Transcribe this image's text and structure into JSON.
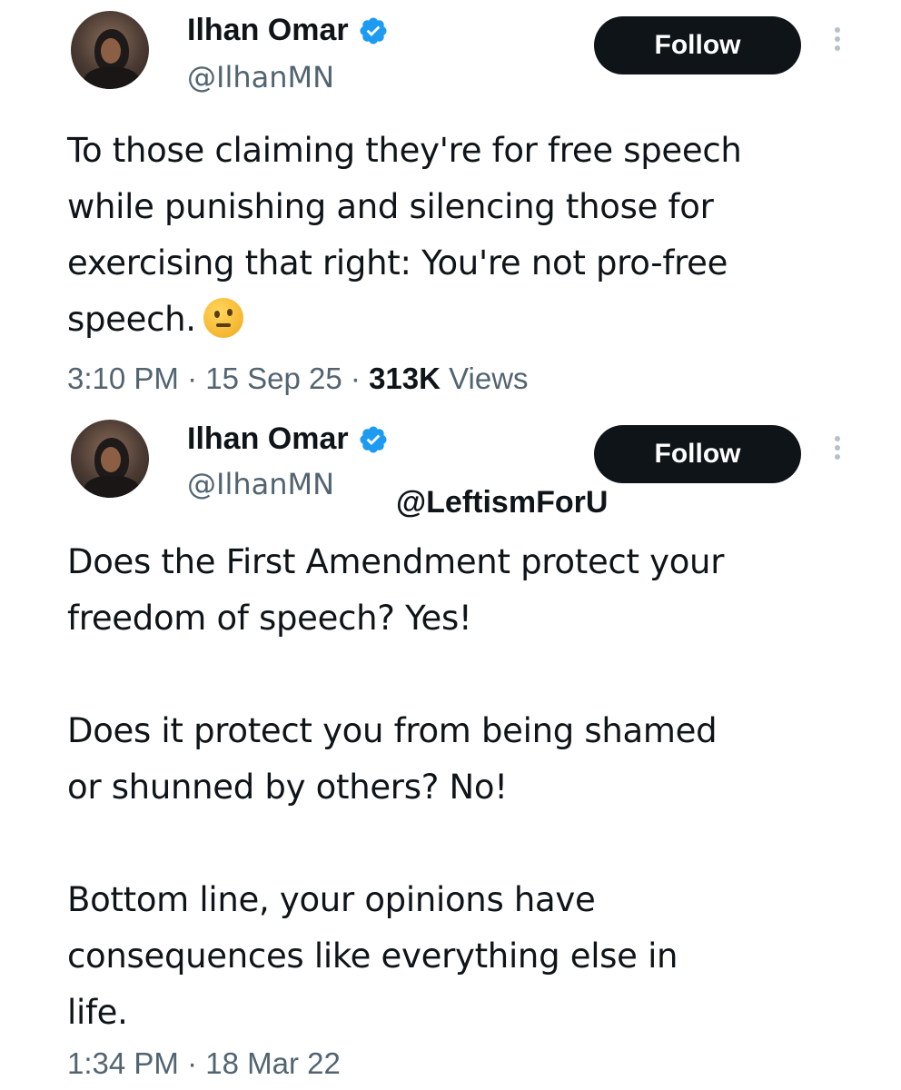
{
  "tweets": [
    {
      "display_name": "Ilhan Omar",
      "handle": "@IlhanMN",
      "follow_label": "Follow",
      "text": "To those claiming they're for free speech\nwhile punishing and silencing those for\nexercising that right: You're not pro-free\nspeech.",
      "emoji": "thinking-face-icon",
      "time": "3:10 PM",
      "date": "15 Sep 25",
      "views_count": "313K",
      "views_label": "Views"
    },
    {
      "display_name": "Ilhan Omar",
      "handle": "@IlhanMN",
      "follow_label": "Follow",
      "text": "Does the First Amendment protect your\nfreedom of speech? Yes!\n\nDoes it protect you from being shamed\nor shunned by others? No!\n\nBottom line, your opinions have\nconsequences like everything else in\nlife.",
      "time": "1:34 PM",
      "date": "18 Mar 22"
    }
  ],
  "watermark": "@LeftismForU",
  "separator": "·",
  "colors": {
    "text": "#0f1419",
    "secondary": "#536471",
    "verified": "#1d9bf0",
    "button_bg": "#0f1419",
    "button_text": "#ffffff"
  }
}
